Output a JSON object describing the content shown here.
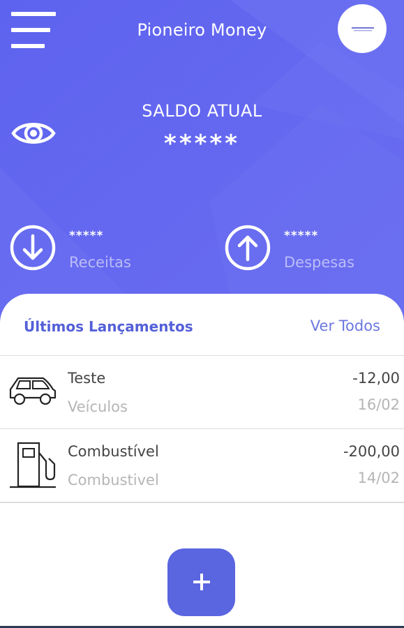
{
  "header": {
    "title": "Pioneiro Money",
    "menu_icon": "hamburger-menu-icon",
    "logo_icon": "brand-logo"
  },
  "balance": {
    "label": "SALDO ATUAL",
    "value": "*****",
    "visibility_icon": "eye-icon"
  },
  "income": {
    "value": "*****",
    "label": "Receitas",
    "icon": "arrow-down-circle-icon"
  },
  "expense": {
    "value": "*****",
    "label": "Despesas",
    "icon": "arrow-up-circle-icon"
  },
  "recent": {
    "title": "Últimos Lançamentos",
    "see_all": "Ver Todos",
    "items": [
      {
        "name": "Teste",
        "category": "Veículos",
        "amount": "-12,00",
        "date": "16/02",
        "icon": "car-icon"
      },
      {
        "name": "Combustível",
        "category": "Combustivel",
        "amount": "-200,00",
        "date": "14/02",
        "icon": "fuel-pump-icon"
      }
    ]
  },
  "fab": {
    "icon": "plus-icon"
  },
  "colors": {
    "hero_bg": "#6467ee",
    "accent": "#5a65e0",
    "title_blue": "#5460d8",
    "muted_text": "#b5b5b5"
  }
}
